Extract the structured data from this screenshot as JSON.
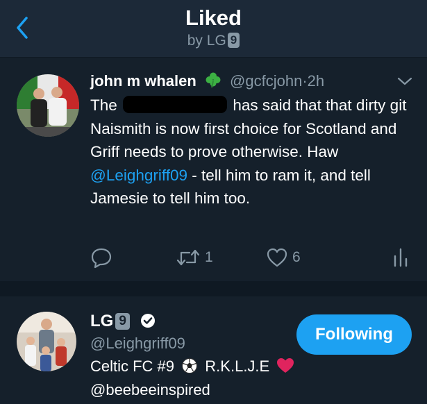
{
  "header": {
    "title": "Liked",
    "subtitle_prefix": "by LG",
    "subtitle_badge": "9"
  },
  "tweet": {
    "display_name": "john m whalen",
    "handle": "@gcfcjohn",
    "separator": "·",
    "time": "2h",
    "body_start": "The",
    "body_after_redaction": "has said that that dirty git Naismith is now first choice for Scotland and Griff needs to prove otherwise. Haw",
    "mention": "@Leighgriff09",
    "body_end": "- tell him to ram it, and tell Jamesie to tell him too.",
    "retweet_count": "1",
    "like_count": "6"
  },
  "user_card": {
    "name": "LG",
    "name_badge": "9",
    "handle": "@Leighgriff09",
    "bio_line1_a": "Celtic FC #9",
    "bio_line1_b": "R.K.L.J.E",
    "bio_line2": "@beebeeinspired",
    "follow_label": "Following"
  },
  "colors": {
    "background": "#15202b",
    "header_bg": "#1c2938",
    "accent": "#1da1f2",
    "muted": "#8899a6"
  },
  "icons": [
    "back-chevron-icon",
    "shamrock-icon",
    "chevron-down-icon",
    "reply-icon",
    "retweet-icon",
    "like-icon",
    "analytics-icon",
    "verified-icon",
    "soccer-ball-icon",
    "heart-emoji-icon"
  ]
}
